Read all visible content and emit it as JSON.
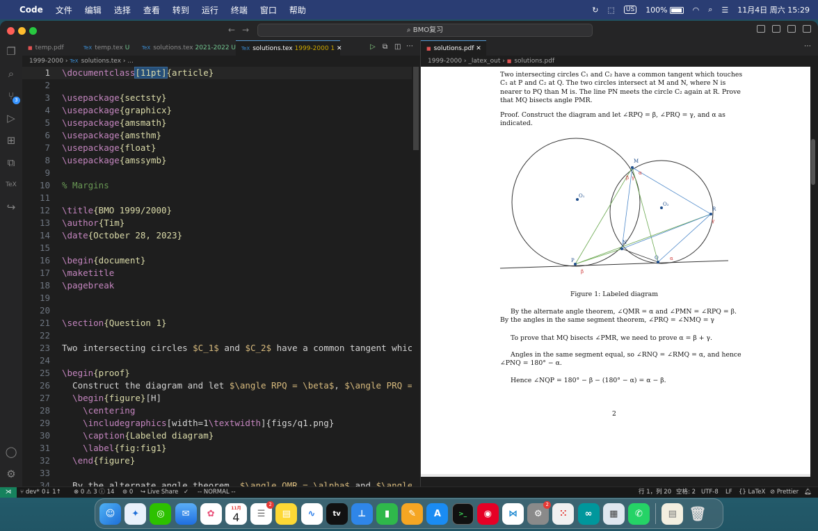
{
  "menubar": {
    "app": "Code",
    "items": [
      "文件",
      "编辑",
      "选择",
      "查看",
      "转到",
      "运行",
      "终端",
      "窗口",
      "帮助"
    ],
    "input_source": "US",
    "battery": "100%",
    "datetime": "11月4日 周六 15:29"
  },
  "window": {
    "search_text": "BMO复习"
  },
  "left_tabs": [
    {
      "icon": "PDF",
      "label": "temp.pdf",
      "extra": ""
    },
    {
      "icon": "TeX",
      "label": "temp.tex",
      "extra": "U"
    },
    {
      "icon": "TeX",
      "label": "solutions.tex",
      "extra": "2021-2022 U"
    },
    {
      "icon": "TeX",
      "label": "solutions.tex",
      "extra": "1999-2000 1"
    }
  ],
  "left_breadcrumb": {
    "folder": "1999-2000",
    "file": "solutions.tex",
    "rest": "..."
  },
  "editor_lines": [
    {
      "n": "1",
      "tokens": [
        {
          "t": "\\documentclass",
          "c": "kw"
        },
        {
          "t": "[11pt]",
          "c": "sel"
        },
        {
          "t": "{article}",
          "c": "arg"
        }
      ]
    },
    {
      "n": "2",
      "tokens": []
    },
    {
      "n": "3",
      "tokens": [
        {
          "t": "\\usepackage",
          "c": "kw"
        },
        {
          "t": "{sectsty}",
          "c": "arg"
        }
      ]
    },
    {
      "n": "4",
      "tokens": [
        {
          "t": "\\usepackage",
          "c": "kw"
        },
        {
          "t": "{graphicx}",
          "c": "arg"
        }
      ]
    },
    {
      "n": "5",
      "tokens": [
        {
          "t": "\\usepackage",
          "c": "kw"
        },
        {
          "t": "{amsmath}",
          "c": "arg"
        }
      ]
    },
    {
      "n": "6",
      "tokens": [
        {
          "t": "\\usepackage",
          "c": "kw"
        },
        {
          "t": "{amsthm}",
          "c": "arg"
        }
      ]
    },
    {
      "n": "7",
      "tokens": [
        {
          "t": "\\usepackage",
          "c": "kw"
        },
        {
          "t": "{float}",
          "c": "arg"
        }
      ]
    },
    {
      "n": "8",
      "tokens": [
        {
          "t": "\\usepackage",
          "c": "kw"
        },
        {
          "t": "{amssymb}",
          "c": "arg"
        }
      ]
    },
    {
      "n": "9",
      "tokens": []
    },
    {
      "n": "10",
      "tokens": [
        {
          "t": "% Margins",
          "c": "com"
        }
      ]
    },
    {
      "n": "11",
      "tokens": []
    },
    {
      "n": "12",
      "tokens": [
        {
          "t": "\\title",
          "c": "kw"
        },
        {
          "t": "{BMO 1999/2000}",
          "c": "arg"
        }
      ]
    },
    {
      "n": "13",
      "tokens": [
        {
          "t": "\\author",
          "c": "kw"
        },
        {
          "t": "{Tim}",
          "c": "arg"
        }
      ]
    },
    {
      "n": "14",
      "tokens": [
        {
          "t": "\\date",
          "c": "kw"
        },
        {
          "t": "{October 28, 2023}",
          "c": "arg"
        }
      ]
    },
    {
      "n": "15",
      "tokens": []
    },
    {
      "n": "16",
      "tokens": [
        {
          "t": "\\begin",
          "c": "kw"
        },
        {
          "t": "{document}",
          "c": "arg"
        }
      ]
    },
    {
      "n": "17",
      "tokens": [
        {
          "t": "\\maketitle",
          "c": "kw"
        }
      ]
    },
    {
      "n": "18",
      "tokens": [
        {
          "t": "\\pagebreak",
          "c": "kw"
        }
      ]
    },
    {
      "n": "19",
      "tokens": []
    },
    {
      "n": "20",
      "tokens": []
    },
    {
      "n": "21",
      "tokens": [
        {
          "t": "\\section",
          "c": "kw"
        },
        {
          "t": "{Question 1}",
          "c": "arg"
        }
      ]
    },
    {
      "n": "22",
      "tokens": []
    },
    {
      "n": "23",
      "tokens": [
        {
          "t": "Two intersecting circles ",
          "c": "pl"
        },
        {
          "t": "$C_1$",
          "c": "math"
        },
        {
          "t": " and ",
          "c": "pl"
        },
        {
          "t": "$C_2$",
          "c": "math"
        },
        {
          "t": " have a common tangent which tou",
          "c": "pl"
        }
      ]
    },
    {
      "n": "24",
      "tokens": []
    },
    {
      "n": "25",
      "tokens": [
        {
          "t": "\\begin",
          "c": "kw"
        },
        {
          "t": "{proof}",
          "c": "arg"
        }
      ]
    },
    {
      "n": "26",
      "tokens": [
        {
          "t": "  Construct the diagram and let ",
          "c": "pl"
        },
        {
          "t": "$\\angle RPQ = \\beta$",
          "c": "math"
        },
        {
          "t": ", ",
          "c": "pl"
        },
        {
          "t": "$\\angle PRQ = \\gam",
          "c": "math"
        }
      ]
    },
    {
      "n": "27",
      "tokens": [
        {
          "t": "  \\begin",
          "c": "kw"
        },
        {
          "t": "{figure}",
          "c": "arg"
        },
        {
          "t": "[H]",
          "c": "fg"
        }
      ]
    },
    {
      "n": "28",
      "tokens": [
        {
          "t": "    \\centering",
          "c": "kw"
        }
      ]
    },
    {
      "n": "29",
      "tokens": [
        {
          "t": "    \\includegraphics",
          "c": "kw"
        },
        {
          "t": "[width=1",
          "c": "fg"
        },
        {
          "t": "\\textwidth",
          "c": "kw"
        },
        {
          "t": "]{figs/q1.png}",
          "c": "fg"
        }
      ]
    },
    {
      "n": "30",
      "tokens": [
        {
          "t": "    \\caption",
          "c": "kw"
        },
        {
          "t": "{Labeled diagram}",
          "c": "arg"
        }
      ]
    },
    {
      "n": "31",
      "tokens": [
        {
          "t": "    \\label",
          "c": "kw"
        },
        {
          "t": "{fig:fig1}",
          "c": "arg"
        }
      ]
    },
    {
      "n": "32",
      "tokens": [
        {
          "t": "  \\end",
          "c": "kw"
        },
        {
          "t": "{figure}",
          "c": "arg"
        }
      ]
    },
    {
      "n": "33",
      "tokens": []
    },
    {
      "n": "34",
      "tokens": [
        {
          "t": "  By the alternate angle theorem, ",
          "c": "pl"
        },
        {
          "t": "$\\angle QMR = \\alpha$",
          "c": "math"
        },
        {
          "t": " and ",
          "c": "pl"
        },
        {
          "t": "$\\angle PMN",
          "c": "math"
        }
      ]
    }
  ],
  "right_tab": {
    "label": "solutions.pdf"
  },
  "right_breadcrumb": {
    "folder": "1999-2000",
    "sub": "_latex_out",
    "file": "solutions.pdf"
  },
  "pdf": {
    "para1": [
      "Two intersecting circles C₁ and C₂ have a common tangent which touches",
      "C₁ at P and C₂ at Q. The two circles intersect at M and N, where N is",
      "nearer to PQ than M is. The line PN meets the circle C₂ again at R. Prove",
      "that MQ bisects angle PMR."
    ],
    "proof": [
      "Proof. Construct the diagram and let ∠RPQ = β, ∠PRQ = γ, and α as",
      "indicated."
    ],
    "caption": "Figure 1: Labeled diagram",
    "para2": [
      "By the alternate angle theorem, ∠QMR = α and ∠PMN = ∠RPQ = β.",
      "By the angles in the same segment theorem, ∠PRQ = ∠NMQ = γ"
    ],
    "para3": "To prove that MQ bisects ∠PMR, we need to prove α = β + γ.",
    "para4": [
      "Angles in the same segment equal, so ∠RNQ = ∠RMQ = α, and hence",
      "∠PNQ = 180° − α."
    ],
    "para5": "Hence ∠NQP = 180° − β − (180° − α) = α − β.",
    "page_number": "2",
    "fig_labels": {
      "M": "M",
      "N": "N",
      "P": "P",
      "Q": "Q",
      "R": "R",
      "O1": "O₁",
      "O2": "O₂",
      "alpha": "α",
      "beta": "β",
      "gamma": "γ"
    }
  },
  "statusbar": {
    "branch": "dev*",
    "sync": "0↓ 1↑",
    "problems": "⊗ 0 ⚠ 3 ⓘ 14",
    "ports": "⊚ 0",
    "liveshare": "Live Share",
    "check": "✓",
    "mode": "-- NORMAL --",
    "position": "行 1，列 20",
    "spaces": "空格: 2",
    "encoding": "UTF-8",
    "eol": "LF",
    "language": "LaTeX",
    "formatter": "Prettier"
  },
  "dock": {
    "calendar_month": "11月",
    "calendar_day": "4",
    "reminders_badge": "2",
    "settings_badge": "2"
  },
  "colors": {
    "menubar": "#2a3d73",
    "statusbar_remote": "#16825d",
    "accent": "#3794ff"
  }
}
